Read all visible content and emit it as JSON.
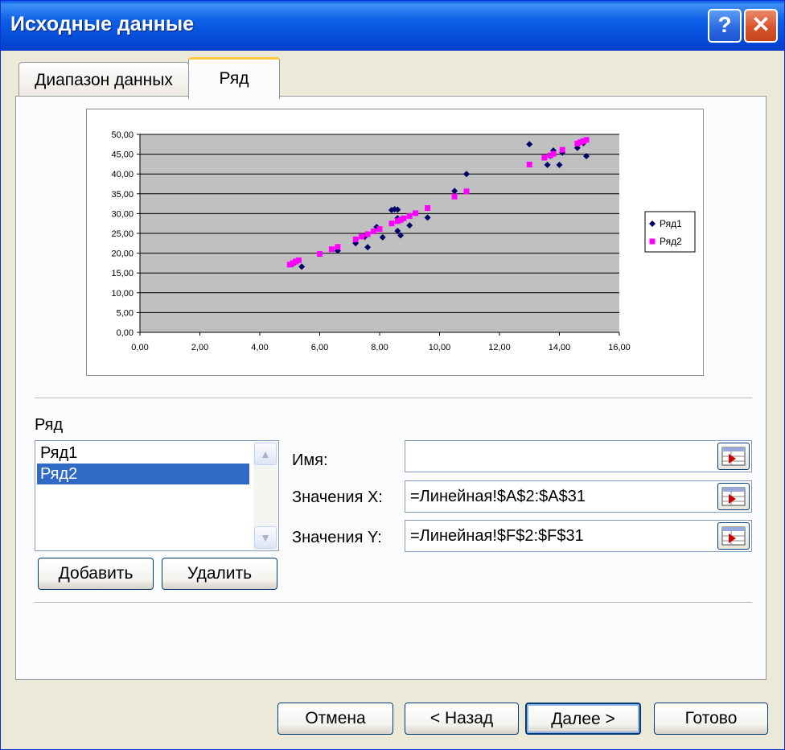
{
  "window": {
    "title": "Исходные данные"
  },
  "tabs": [
    {
      "label": "Диапазон данных"
    },
    {
      "label": "Ряд"
    }
  ],
  "series_section": {
    "label": "Ряд",
    "items": [
      "Ряд1",
      "Ряд2"
    ],
    "selected": "Ряд2",
    "add_button": "Добавить",
    "delete_button": "Удалить"
  },
  "fields": {
    "name": {
      "label": "Имя:",
      "value": ""
    },
    "x_values": {
      "label": "Значения X:",
      "value": "=Линейная!$A$2:$A$31"
    },
    "y_values": {
      "label": "Значения Y:",
      "value": "=Линейная!$F$2:$F$31"
    }
  },
  "footer": {
    "cancel": "Отмена",
    "back": "< Назад",
    "next": "Далее >",
    "finish": "Готово"
  },
  "chart_data": {
    "type": "scatter",
    "xlim": [
      0,
      16
    ],
    "ylim": [
      0,
      50
    ],
    "xticks": [
      "0,00",
      "2,00",
      "4,00",
      "6,00",
      "8,00",
      "10,00",
      "12,00",
      "14,00",
      "16,00"
    ],
    "yticks": [
      "0,00",
      "5,00",
      "10,00",
      "15,00",
      "20,00",
      "25,00",
      "30,00",
      "35,00",
      "40,00",
      "45,00",
      "50,00"
    ],
    "grid": true,
    "legend_position": "right",
    "plot_background": "#c0c0c0",
    "series": [
      {
        "name": "Ряд1",
        "color": "#000066",
        "marker": "diamond",
        "points": [
          [
            5.1,
            17.3
          ],
          [
            5.2,
            17.8
          ],
          [
            5.4,
            16.6
          ],
          [
            6.6,
            20.6
          ],
          [
            7.2,
            22.5
          ],
          [
            7.5,
            24.1
          ],
          [
            7.6,
            21.5
          ],
          [
            7.9,
            26.6
          ],
          [
            8.1,
            24.0
          ],
          [
            8.4,
            30.9
          ],
          [
            8.5,
            31.1
          ],
          [
            8.6,
            25.6
          ],
          [
            8.6,
            28.8
          ],
          [
            8.6,
            31.0
          ],
          [
            8.7,
            24.5
          ],
          [
            9.0,
            27.0
          ],
          [
            9.6,
            29.0
          ],
          [
            10.5,
            35.7
          ],
          [
            10.9,
            40.0
          ],
          [
            13.0,
            47.5
          ],
          [
            13.6,
            42.3
          ],
          [
            13.7,
            44.6
          ],
          [
            13.8,
            45.9
          ],
          [
            14.0,
            42.3
          ],
          [
            14.1,
            45.4
          ],
          [
            14.6,
            46.6
          ],
          [
            14.8,
            47.8
          ],
          [
            14.9,
            44.5
          ]
        ]
      },
      {
        "name": "Ряд2",
        "color": "#ff00ff",
        "marker": "square",
        "points": [
          [
            5.0,
            17.1
          ],
          [
            5.1,
            17.5
          ],
          [
            5.2,
            17.9
          ],
          [
            5.3,
            18.2
          ],
          [
            6.0,
            19.8
          ],
          [
            6.4,
            21.0
          ],
          [
            6.6,
            21.6
          ],
          [
            7.2,
            23.5
          ],
          [
            7.4,
            24.2
          ],
          [
            7.6,
            24.8
          ],
          [
            7.8,
            25.5
          ],
          [
            8.0,
            26.1
          ],
          [
            8.4,
            27.5
          ],
          [
            8.6,
            28.1
          ],
          [
            8.7,
            28.4
          ],
          [
            8.8,
            28.8
          ],
          [
            9.0,
            29.4
          ],
          [
            9.2,
            30.1
          ],
          [
            9.6,
            31.4
          ],
          [
            10.5,
            34.3
          ],
          [
            10.9,
            35.6
          ],
          [
            13.0,
            42.4
          ],
          [
            13.5,
            44.1
          ],
          [
            13.7,
            44.7
          ],
          [
            13.8,
            45.1
          ],
          [
            14.1,
            46.1
          ],
          [
            14.6,
            47.7
          ],
          [
            14.7,
            48.0
          ],
          [
            14.8,
            48.3
          ],
          [
            14.9,
            48.6
          ]
        ]
      }
    ]
  }
}
